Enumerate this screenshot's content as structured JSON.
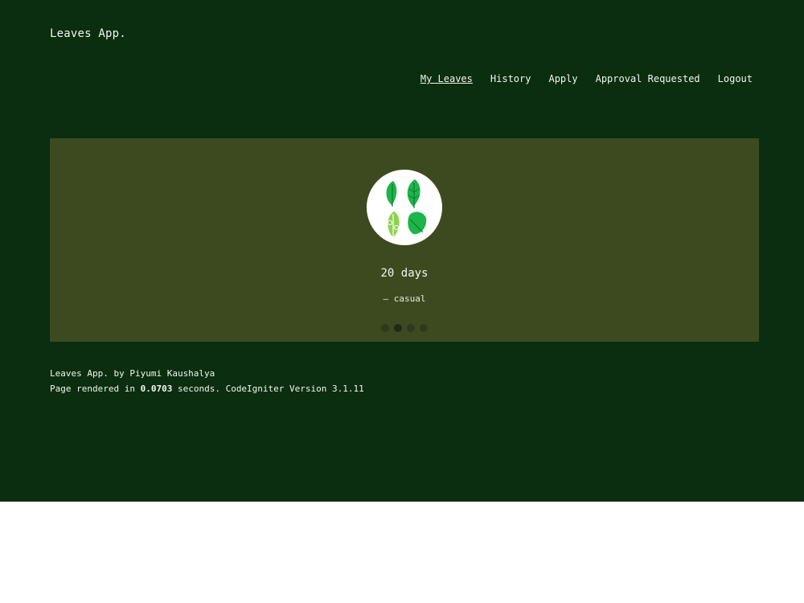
{
  "header": {
    "brand": "Leaves App."
  },
  "nav": {
    "items": [
      {
        "label": "My Leaves",
        "active": true
      },
      {
        "label": "History",
        "active": false
      },
      {
        "label": "Apply",
        "active": false
      },
      {
        "label": "Approval Requested",
        "active": false
      },
      {
        "label": "Logout",
        "active": false
      }
    ]
  },
  "carousel": {
    "avatar_icon": "leaves-illustration-icon",
    "title": "20 days",
    "subtitle": "— casual",
    "dot_count": 4,
    "active_index": 1,
    "colors": {
      "background": "#3d4a1f",
      "leaf_dark": "#1db54a",
      "leaf_light": "#8fd14f"
    }
  },
  "footer": {
    "line1": "Leaves App. by Piyumi Kaushalya",
    "line2_prefix": "Page rendered in ",
    "line2_time": "0.0703",
    "line2_suffix": " seconds. CodeIgniter Version 3.1.11"
  },
  "theme": {
    "page_bg": "#0a2e0f"
  }
}
